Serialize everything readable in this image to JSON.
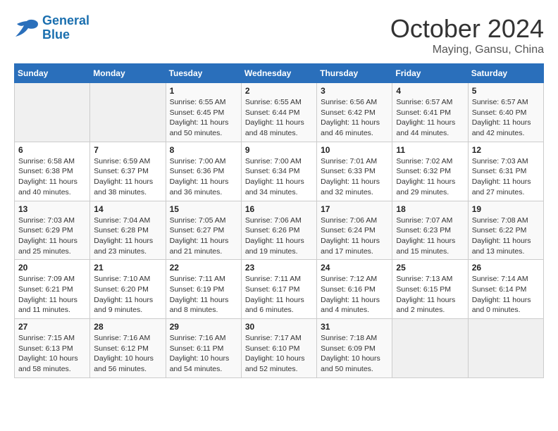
{
  "header": {
    "logo_line1": "General",
    "logo_line2": "Blue",
    "month": "October 2024",
    "location": "Maying, Gansu, China"
  },
  "days_of_week": [
    "Sunday",
    "Monday",
    "Tuesday",
    "Wednesday",
    "Thursday",
    "Friday",
    "Saturday"
  ],
  "weeks": [
    [
      {
        "day": "",
        "info": ""
      },
      {
        "day": "",
        "info": ""
      },
      {
        "day": "1",
        "info": "Sunrise: 6:55 AM\nSunset: 6:45 PM\nDaylight: 11 hours and 50 minutes."
      },
      {
        "day": "2",
        "info": "Sunrise: 6:55 AM\nSunset: 6:44 PM\nDaylight: 11 hours and 48 minutes."
      },
      {
        "day": "3",
        "info": "Sunrise: 6:56 AM\nSunset: 6:42 PM\nDaylight: 11 hours and 46 minutes."
      },
      {
        "day": "4",
        "info": "Sunrise: 6:57 AM\nSunset: 6:41 PM\nDaylight: 11 hours and 44 minutes."
      },
      {
        "day": "5",
        "info": "Sunrise: 6:57 AM\nSunset: 6:40 PM\nDaylight: 11 hours and 42 minutes."
      }
    ],
    [
      {
        "day": "6",
        "info": "Sunrise: 6:58 AM\nSunset: 6:38 PM\nDaylight: 11 hours and 40 minutes."
      },
      {
        "day": "7",
        "info": "Sunrise: 6:59 AM\nSunset: 6:37 PM\nDaylight: 11 hours and 38 minutes."
      },
      {
        "day": "8",
        "info": "Sunrise: 7:00 AM\nSunset: 6:36 PM\nDaylight: 11 hours and 36 minutes."
      },
      {
        "day": "9",
        "info": "Sunrise: 7:00 AM\nSunset: 6:34 PM\nDaylight: 11 hours and 34 minutes."
      },
      {
        "day": "10",
        "info": "Sunrise: 7:01 AM\nSunset: 6:33 PM\nDaylight: 11 hours and 32 minutes."
      },
      {
        "day": "11",
        "info": "Sunrise: 7:02 AM\nSunset: 6:32 PM\nDaylight: 11 hours and 29 minutes."
      },
      {
        "day": "12",
        "info": "Sunrise: 7:03 AM\nSunset: 6:31 PM\nDaylight: 11 hours and 27 minutes."
      }
    ],
    [
      {
        "day": "13",
        "info": "Sunrise: 7:03 AM\nSunset: 6:29 PM\nDaylight: 11 hours and 25 minutes."
      },
      {
        "day": "14",
        "info": "Sunrise: 7:04 AM\nSunset: 6:28 PM\nDaylight: 11 hours and 23 minutes."
      },
      {
        "day": "15",
        "info": "Sunrise: 7:05 AM\nSunset: 6:27 PM\nDaylight: 11 hours and 21 minutes."
      },
      {
        "day": "16",
        "info": "Sunrise: 7:06 AM\nSunset: 6:26 PM\nDaylight: 11 hours and 19 minutes."
      },
      {
        "day": "17",
        "info": "Sunrise: 7:06 AM\nSunset: 6:24 PM\nDaylight: 11 hours and 17 minutes."
      },
      {
        "day": "18",
        "info": "Sunrise: 7:07 AM\nSunset: 6:23 PM\nDaylight: 11 hours and 15 minutes."
      },
      {
        "day": "19",
        "info": "Sunrise: 7:08 AM\nSunset: 6:22 PM\nDaylight: 11 hours and 13 minutes."
      }
    ],
    [
      {
        "day": "20",
        "info": "Sunrise: 7:09 AM\nSunset: 6:21 PM\nDaylight: 11 hours and 11 minutes."
      },
      {
        "day": "21",
        "info": "Sunrise: 7:10 AM\nSunset: 6:20 PM\nDaylight: 11 hours and 9 minutes."
      },
      {
        "day": "22",
        "info": "Sunrise: 7:11 AM\nSunset: 6:19 PM\nDaylight: 11 hours and 8 minutes."
      },
      {
        "day": "23",
        "info": "Sunrise: 7:11 AM\nSunset: 6:17 PM\nDaylight: 11 hours and 6 minutes."
      },
      {
        "day": "24",
        "info": "Sunrise: 7:12 AM\nSunset: 6:16 PM\nDaylight: 11 hours and 4 minutes."
      },
      {
        "day": "25",
        "info": "Sunrise: 7:13 AM\nSunset: 6:15 PM\nDaylight: 11 hours and 2 minutes."
      },
      {
        "day": "26",
        "info": "Sunrise: 7:14 AM\nSunset: 6:14 PM\nDaylight: 11 hours and 0 minutes."
      }
    ],
    [
      {
        "day": "27",
        "info": "Sunrise: 7:15 AM\nSunset: 6:13 PM\nDaylight: 10 hours and 58 minutes."
      },
      {
        "day": "28",
        "info": "Sunrise: 7:16 AM\nSunset: 6:12 PM\nDaylight: 10 hours and 56 minutes."
      },
      {
        "day": "29",
        "info": "Sunrise: 7:16 AM\nSunset: 6:11 PM\nDaylight: 10 hours and 54 minutes."
      },
      {
        "day": "30",
        "info": "Sunrise: 7:17 AM\nSunset: 6:10 PM\nDaylight: 10 hours and 52 minutes."
      },
      {
        "day": "31",
        "info": "Sunrise: 7:18 AM\nSunset: 6:09 PM\nDaylight: 10 hours and 50 minutes."
      },
      {
        "day": "",
        "info": ""
      },
      {
        "day": "",
        "info": ""
      }
    ]
  ]
}
